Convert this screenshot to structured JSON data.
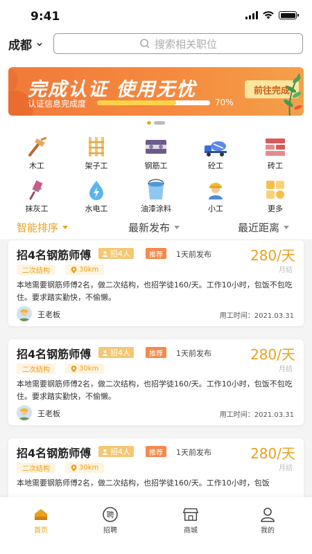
{
  "status_bar": {
    "time": "9:41"
  },
  "header": {
    "city": "成都",
    "search_placeholder": "搜索相关职位"
  },
  "banner": {
    "title": "完成认证 使用无忧",
    "progress_label": "认证信息完成度",
    "progress": 0.7,
    "progress_text": "70%",
    "button": "前往完成"
  },
  "carousel": {
    "current": 1,
    "total": 2
  },
  "categories": [
    {
      "label": "木工",
      "icon": "hammer-icon"
    },
    {
      "label": "架子工",
      "icon": "scaffold-icon"
    },
    {
      "label": "钢筋工",
      "icon": "rebar-icon"
    },
    {
      "label": "砼工",
      "icon": "concrete-mixer-icon"
    },
    {
      "label": "砖工",
      "icon": "brick-icon"
    },
    {
      "label": "抹灰工",
      "icon": "trowel-icon"
    },
    {
      "label": "水电工",
      "icon": "water-electric-icon"
    },
    {
      "label": "油漆涂料",
      "icon": "paint-bucket-icon"
    },
    {
      "label": "小工",
      "icon": "worker-icon"
    },
    {
      "label": "更多",
      "icon": "more-grid-icon"
    }
  ],
  "sort": {
    "smart": "智能排序",
    "latest": "最新发布",
    "nearest": "最近距离",
    "active": "smart"
  },
  "jobs": [
    {
      "title": "招4名钢筋师傅",
      "hire": "招4人",
      "recommend": "推荐",
      "posted": "1天前发布",
      "salary": "280/天",
      "pay_cycle": "月结",
      "structure": "二次结构",
      "distance": "30km",
      "description": "本地需要钢筋师傅2名，做二次结构，也招学徒160/天。工作10小时，包饭不包吃住。要求踏实勤快，不偷懒。",
      "employer": "王老板",
      "work_date": "用工时间：2021.03.31"
    },
    {
      "title": "招4名钢筋师傅",
      "hire": "招4人",
      "recommend": "推荐",
      "posted": "1天前发布",
      "salary": "280/天",
      "pay_cycle": "月结",
      "structure": "二次结构",
      "distance": "30km",
      "description": "本地需要钢筋师傅2名，做二次结构，也招学徒160/天。工作10小时，包饭不包吃住。要求踏实勤快，不偷懒。",
      "employer": "王老板",
      "work_date": "用工时间：2021.03.31"
    },
    {
      "title": "招4名钢筋师傅",
      "hire": "招4人",
      "recommend": "推荐",
      "posted": "1天前发布",
      "salary": "280/天",
      "pay_cycle": "月结",
      "structure": "二次结构",
      "distance": "30km",
      "description": "本地需要钢筋师傅2名，做二次结构，也招学徒160/天。工作10小时，包饭",
      "employer": "",
      "work_date": ""
    }
  ],
  "tabbar": [
    {
      "label": "首页",
      "icon": "home-icon",
      "active": true
    },
    {
      "label": "招聘",
      "icon": "recruit-icon",
      "active": false
    },
    {
      "label": "商城",
      "icon": "shop-icon",
      "active": false
    },
    {
      "label": "我的",
      "icon": "profile-icon",
      "active": false
    }
  ],
  "colors": {
    "accent": "#e8a11e",
    "banner": "#f58a3e",
    "recommend": "#f6894a"
  }
}
